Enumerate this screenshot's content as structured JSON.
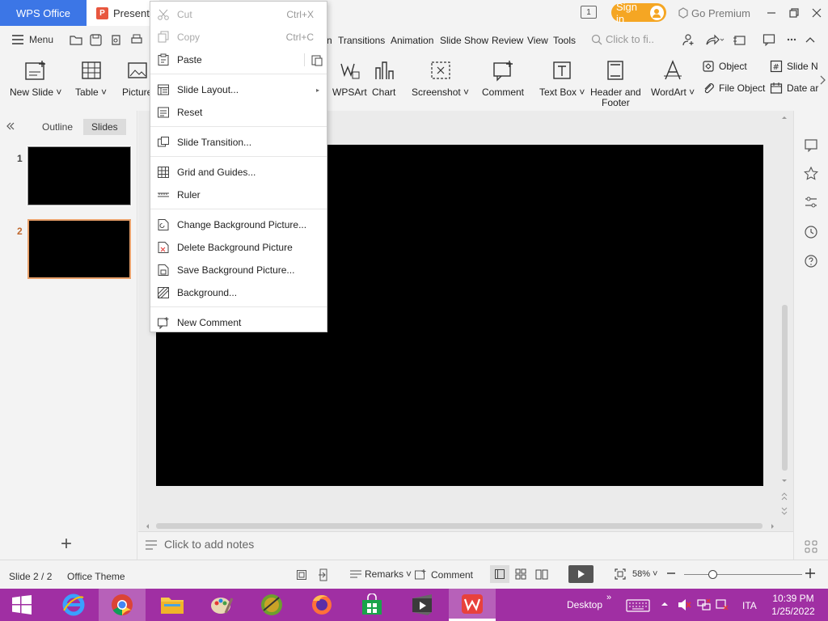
{
  "titlebar": {
    "wps_tab": "WPS Office",
    "doc_tab": "Presenta",
    "doc_icon": "P",
    "page_indicator": "1",
    "sign_in": "Sign in",
    "go_premium": "Go Premium"
  },
  "menu": {
    "menu_label": "Menu",
    "tabs": [
      "n",
      "Transitions",
      "Animation",
      "Slide Show",
      "Review",
      "View",
      "Tools"
    ],
    "search_placeholder": "Click to fi.."
  },
  "ribbon": {
    "new_slide": "New Slide",
    "table": "Table",
    "picture": "Picture",
    "wpsart": "WPSArt",
    "chart": "Chart",
    "screenshot": "Screenshot",
    "comment": "Comment",
    "textbox": "Text Box",
    "header_footer_1": "Header and",
    "header_footer_2": "Footer",
    "wordart": "WordArt",
    "object": "Object",
    "file_object": "File Object",
    "slide_number": "Slide N",
    "date_and": "Date ar"
  },
  "leftpane": {
    "outline_tab": "Outline",
    "slides_tab": "Slides",
    "slide_numbers": [
      "1",
      "2"
    ],
    "add": "+"
  },
  "notes": {
    "placeholder": "Click to add notes"
  },
  "statusbar": {
    "slide_info": "Slide 2 / 2",
    "theme": "Office Theme",
    "remarks": "Remarks",
    "comment": "Comment",
    "zoom": "58%",
    "zoom_level": 0.58
  },
  "taskbar": {
    "desktop": "Desktop",
    "language": "ITA",
    "time": "10:39 PM",
    "date": "1/25/2022"
  },
  "context_menu": {
    "cut": "Cut",
    "cut_shortcut": "Ctrl+X",
    "copy": "Copy",
    "copy_shortcut": "Ctrl+C",
    "paste": "Paste",
    "slide_layout": "Slide Layout...",
    "reset": "Reset",
    "slide_transition": "Slide Transition...",
    "grid_guides": "Grid and Guides...",
    "ruler": "Ruler",
    "change_bg": "Change Background Picture...",
    "delete_bg": "Delete Background Picture",
    "save_bg": "Save Background Picture...",
    "background": "Background...",
    "new_comment": "New Comment"
  },
  "colors": {
    "wps_blue": "#3c76e6",
    "sign_in_orange": "#f5a623",
    "taskbar_purple": "#a02fa3",
    "selected_thumb_border": "#e8a06a",
    "slide_bg": "#000000"
  }
}
